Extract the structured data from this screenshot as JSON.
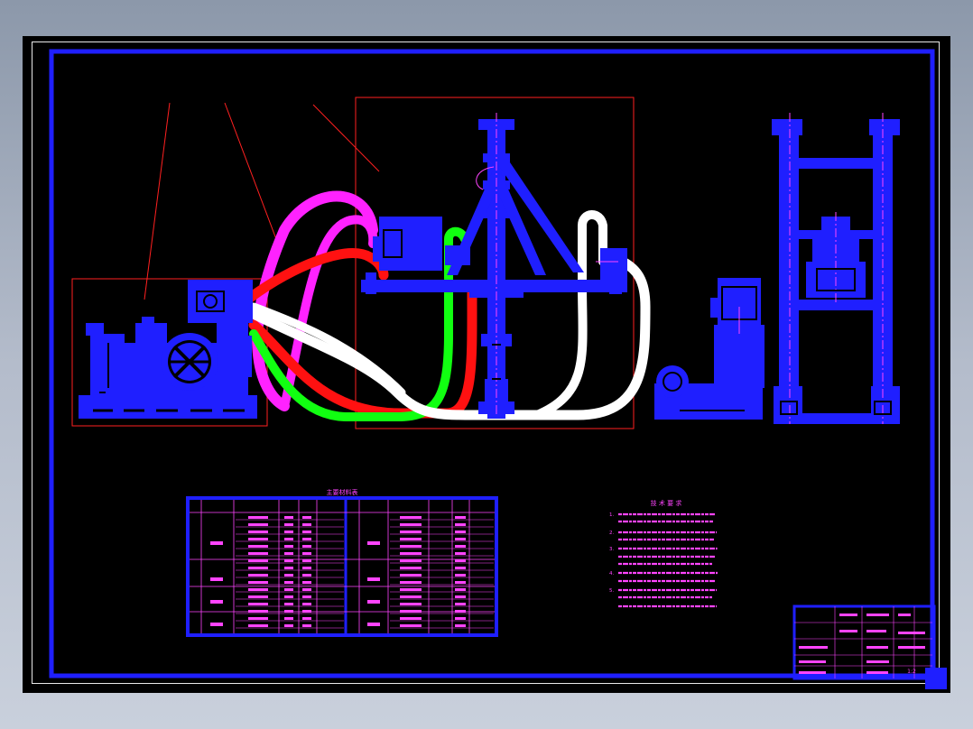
{
  "drawing": {
    "background": "#000000",
    "colors": {
      "frame": "#1f1fff",
      "machine": "#1f1fff",
      "hose_magenta": "#ff22ff",
      "hose_red": "#ff1111",
      "hose_green": "#11ff11",
      "hose_white": "#ffffff",
      "leader": "#ff2020",
      "table_text": "#ff44ff"
    },
    "components": [
      "pump-unit",
      "press-with-rams",
      "right-front-elevation",
      "right-side-elevation"
    ],
    "icons": [
      "flywheel-icon"
    ]
  },
  "materials_table": {
    "title": "主要材料表"
  },
  "technical_notes": {
    "title": "技 术 要 求",
    "numbers": [
      "1.",
      "2.",
      "3.",
      "4.",
      "5."
    ]
  },
  "title_block": {
    "sheet_label": "1:2"
  }
}
